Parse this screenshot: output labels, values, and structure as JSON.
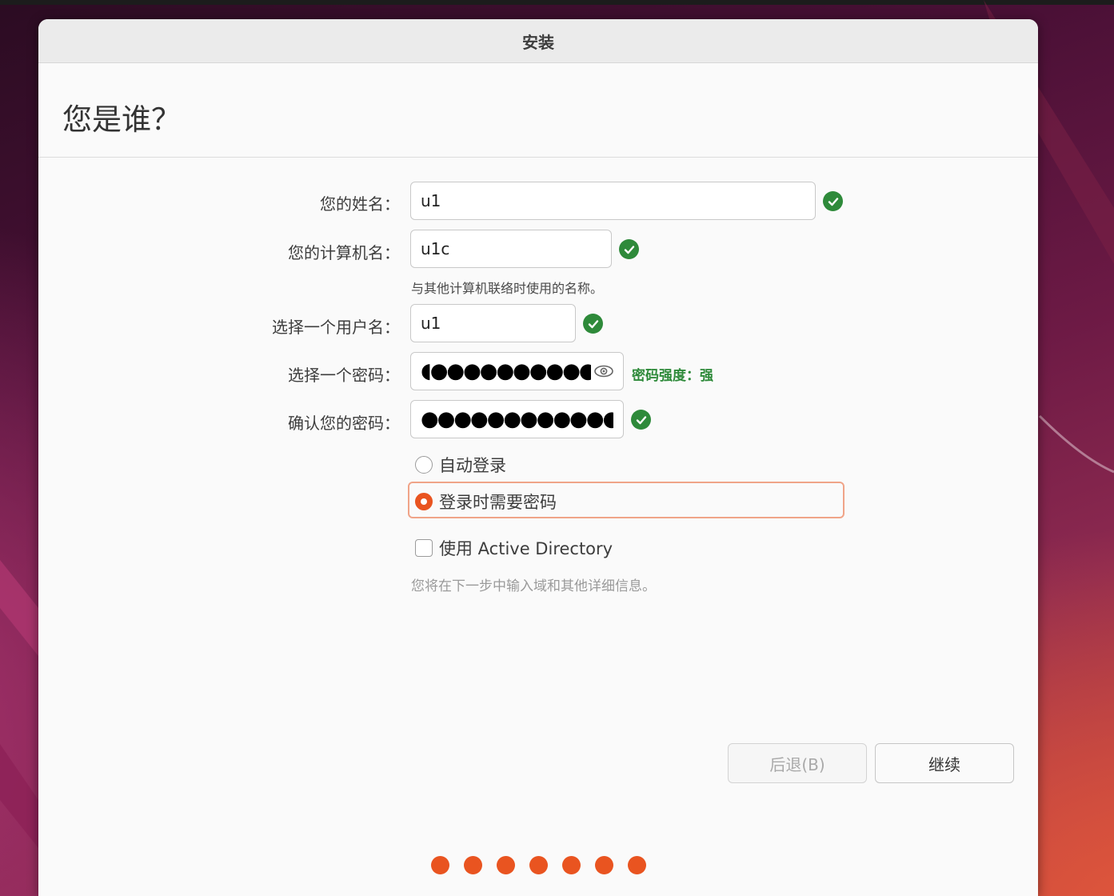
{
  "window": {
    "title": "安装"
  },
  "page": {
    "heading": "您是谁？"
  },
  "form": {
    "name": {
      "label": "您的姓名：",
      "value": "u1"
    },
    "computer": {
      "label": "您的计算机名：",
      "value": "u1c",
      "hint": "与其他计算机联络时使用的名称。"
    },
    "username": {
      "label": "选择一个用户名：",
      "value": "u1"
    },
    "password": {
      "label": "选择一个密码：",
      "masked": "◖●●●●●●●●●●●",
      "strength": "密码强度：强"
    },
    "confirm": {
      "label": "确认您的密码：",
      "masked": "●●●●●●●●●●●●●"
    },
    "login": {
      "auto_label": "自动登录",
      "require_label": "登录时需要密码",
      "selected": "require"
    },
    "ad": {
      "label": "使用 Active Directory",
      "hint": "您将在下一步中输入域和其他详细信息。",
      "checked": false
    }
  },
  "buttons": {
    "back": "后退(B)",
    "continue": "继续"
  },
  "progress": {
    "total_steps": 7
  },
  "colors": {
    "accent": "#e95420",
    "success": "#2e8a3a",
    "focus_ring": "#f0a488"
  },
  "icons": {
    "valid": "check-circle-icon",
    "reveal": "eye-icon"
  }
}
